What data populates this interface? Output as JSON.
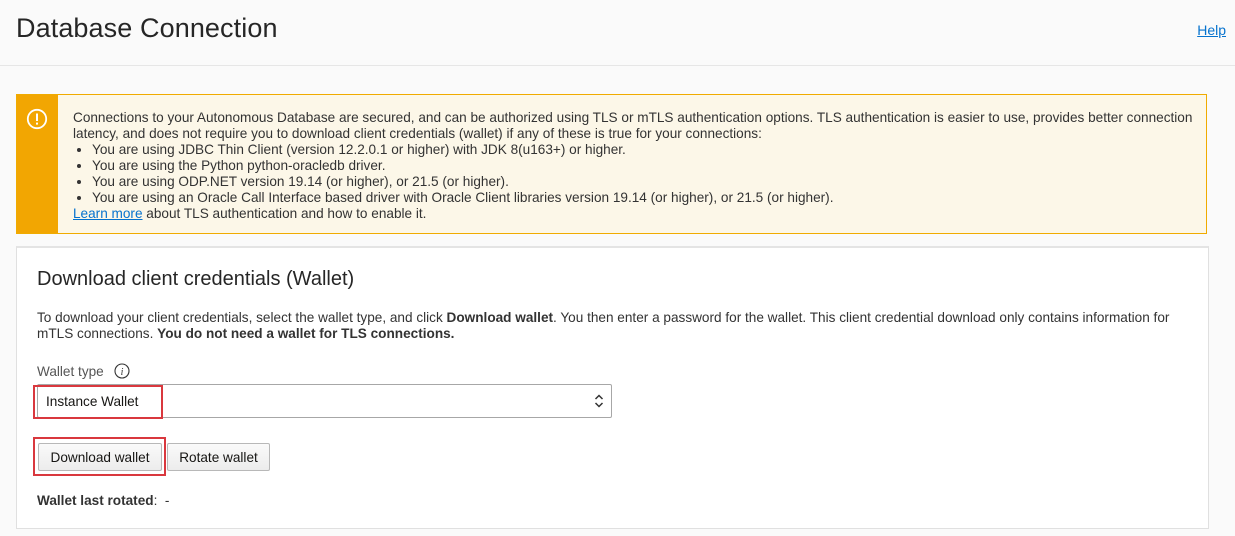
{
  "header": {
    "title": "Database Connection",
    "help_label": "Help"
  },
  "notice": {
    "icon": "warning-circle-icon",
    "accent_color": "#f2a602",
    "intro": "Connections to your Autonomous Database are secured, and can be authorized using TLS or mTLS authentication options. TLS authentication is easier to use, provides better connection latency, and does not require you to download client credentials (wallet) if any of these is true for your connections:",
    "bullets": [
      "You are using JDBC Thin Client (version 12.2.0.1 or higher) with JDK 8(u163+) or higher.",
      "You are using the Python python-oracledb driver.",
      "You are using ODP.NET version 19.14 (or higher), or 21.5 (or higher).",
      "You are using an Oracle Call Interface based driver with Oracle Client libraries version 19.14 (or higher), or 21.5 (or higher)."
    ],
    "learn_more_label": "Learn more",
    "learn_more_suffix": " about TLS authentication and how to enable it."
  },
  "wallet": {
    "title": "Download client credentials (Wallet)",
    "desc_part1": "To download your client credentials, select the wallet type, and click ",
    "desc_bold1": "Download wallet",
    "desc_part2": ". You then enter a password for the wallet. This client credential download only contains information for mTLS connections. ",
    "desc_bold2": "You do not need a wallet for TLS connections.",
    "type_label": "Wallet type",
    "type_info_icon": "info-icon",
    "type_value": "Instance Wallet",
    "download_label": "Download wallet",
    "rotate_label": "Rotate wallet",
    "last_rotated_label": "Wallet last rotated",
    "last_rotated_sep": ":",
    "last_rotated_value": "-"
  },
  "colors": {
    "link": "#0572ce",
    "highlight": "#d9383e"
  }
}
